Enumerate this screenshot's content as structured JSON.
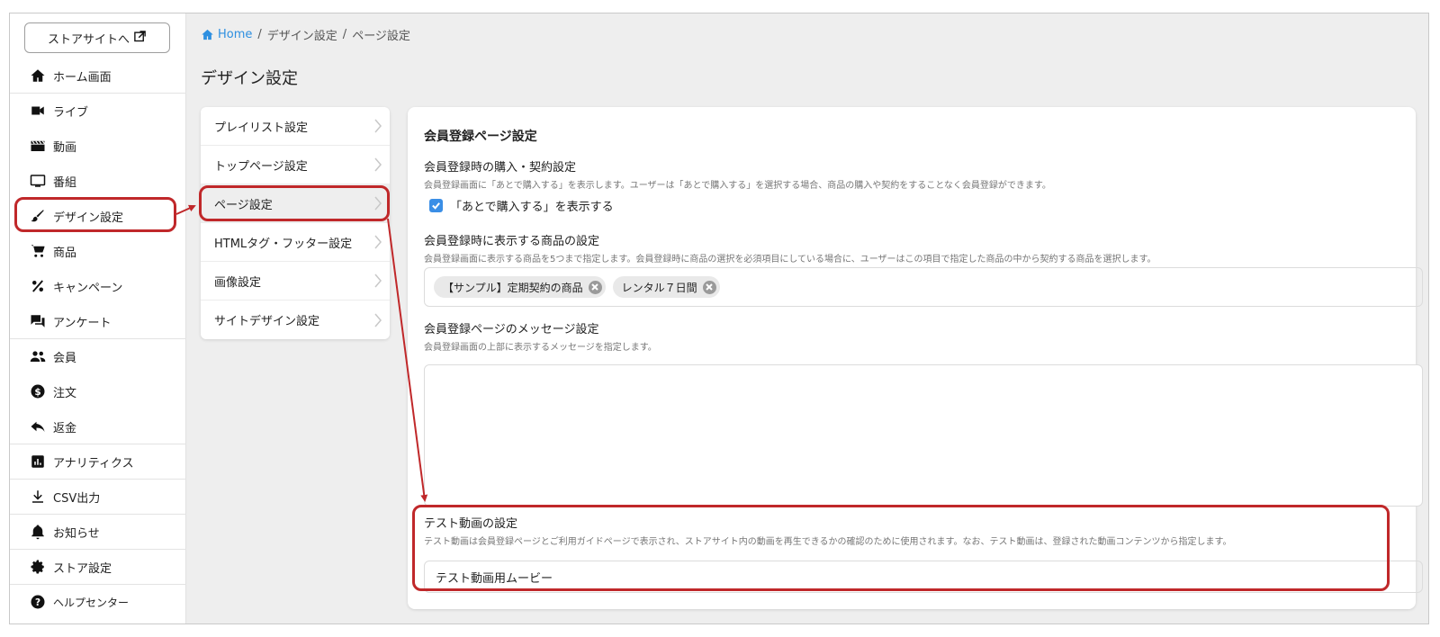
{
  "sidebar": {
    "store_button": "ストアサイトへ",
    "items": [
      {
        "label": "ホーム画面",
        "icon": "home-icon"
      },
      {
        "label": "ライブ",
        "icon": "videocam-icon"
      },
      {
        "label": "動画",
        "icon": "movie-icon"
      },
      {
        "label": "番組",
        "icon": "tv-icon"
      },
      {
        "label": "デザイン設定",
        "icon": "brush-icon"
      },
      {
        "label": "商品",
        "icon": "cart-icon"
      },
      {
        "label": "キャンペーン",
        "icon": "percent-icon"
      },
      {
        "label": "アンケート",
        "icon": "forum-icon"
      },
      {
        "label": "会員",
        "icon": "people-icon"
      },
      {
        "label": "注文",
        "icon": "dollar-icon"
      },
      {
        "label": "返金",
        "icon": "reply-icon"
      },
      {
        "label": "アナリティクス",
        "icon": "analytics-icon"
      },
      {
        "label": "CSV出力",
        "icon": "download-icon"
      },
      {
        "label": "お知らせ",
        "icon": "bell-icon"
      },
      {
        "label": "ストア設定",
        "icon": "gear-icon"
      },
      {
        "label": "ヘルプセンター",
        "icon": "help-icon"
      }
    ]
  },
  "breadcrumb": {
    "home": "Home",
    "sep": "/",
    "level1": "デザイン設定",
    "level2": "ページ設定"
  },
  "page_title": "デザイン設定",
  "submenu": [
    "プレイリスト設定",
    "トップページ設定",
    "ページ設定",
    "HTMLタグ・フッター設定",
    "画像設定",
    "サイトデザイン設定"
  ],
  "card": {
    "title": "会員登録ページ設定",
    "purchase": {
      "label": "会員登録時の購入・契約設定",
      "desc": "会員登録画面に「あとで購入する」を表示します。ユーザーは「あとで購入する」を選択する場合、商品の購入や契約をすることなく会員登録ができます。",
      "checkbox_label": "「あとで購入する」を表示する"
    },
    "products": {
      "label": "会員登録時に表示する商品の設定",
      "desc": "会員登録画面に表示する商品を5つまで指定します。会員登録時に商品の選択を必須項目にしている場合に、ユーザーはこの項目で指定した商品の中から契約する商品を選択します。",
      "chips": [
        "【サンプル】定期契約の商品",
        "レンタル７日間"
      ]
    },
    "message": {
      "label": "会員登録ページのメッセージ設定",
      "desc": "会員登録画面の上部に表示するメッセージを指定します。"
    },
    "test_video": {
      "label": "テスト動画の設定",
      "desc": "テスト動画は会員登録ページとご利用ガイドページで表示され、ストアサイト内の動画を再生できるかの確認のために使用されます。なお、テスト動画は、登録された動画コンテンツから指定します。",
      "value": "テスト動画用ムービー"
    }
  },
  "colors": {
    "highlight": "#c0282a",
    "link": "#2d8fe0",
    "checkbox": "#3a8ee6"
  }
}
